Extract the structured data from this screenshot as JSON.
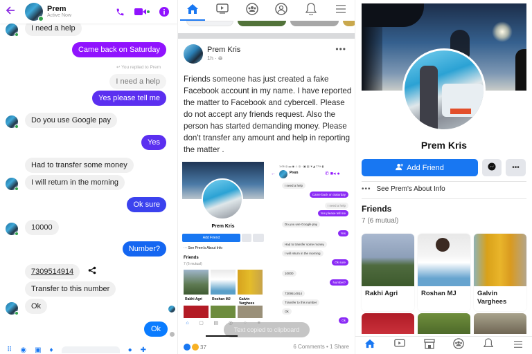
{
  "messenger": {
    "contact_name": "Prem",
    "status": "Active Now",
    "messages": [
      {
        "dir": "in",
        "text": "I need a help"
      },
      {
        "dir": "out",
        "text": "Came back on Saturday"
      },
      {
        "dir": "note",
        "text": "You replied to Prem"
      },
      {
        "dir": "quoted",
        "text": "I need a help"
      },
      {
        "dir": "out",
        "text": "Yes please tell me"
      },
      {
        "dir": "in",
        "text": "Do you use Google pay"
      },
      {
        "dir": "out",
        "text": "Yes"
      },
      {
        "dir": "in",
        "text": "Had to transfer some money"
      },
      {
        "dir": "in",
        "text": "I will return in the morning"
      },
      {
        "dir": "out",
        "text": "Ok sure"
      },
      {
        "dir": "in",
        "text": "10000"
      },
      {
        "dir": "out",
        "text": "Number?"
      },
      {
        "dir": "in",
        "text": "7309514914"
      },
      {
        "dir": "in",
        "text": "Transfer to this number"
      },
      {
        "dir": "in",
        "text": "Ok"
      },
      {
        "dir": "out",
        "text": "Ok"
      }
    ],
    "colors": {
      "accent": "#9013fe",
      "blue": "#0a7cff",
      "online": "#31a24c"
    }
  },
  "feed": {
    "nav": [
      "home-icon",
      "video-icon",
      "groups-icon",
      "profile-icon",
      "bell-icon",
      "menu-icon"
    ],
    "post": {
      "author": "Prem Kris",
      "time": "1h",
      "privacy": "globe-icon",
      "text": "Friends someone has just created a fake Facebook account in my name. I have reported the matter to Facebook and cybercell. Please do not accept any friends request. Also the person has started demanding money. Please don't transfer any amount  and help in reporting the matter .",
      "reaction_count": "37",
      "comments_shares": "6 Comments • 1 Share"
    },
    "embedded": {
      "profile_name": "Prem Kris",
      "add_friend": "Add Friend",
      "about": "See Prem's About Info",
      "friends_title": "Friends",
      "friends_count": "7 (6 mutual)",
      "friends": [
        "Rakhi Agri",
        "Roshan MJ",
        "Galvin Varghees"
      ],
      "toast": "Text copied to clipboard",
      "chat": [
        {
          "dir": "in",
          "text": "I need a help"
        },
        {
          "dir": "out",
          "text": "Came back on Saturday"
        },
        {
          "dir": "quoted",
          "text": "I need a help"
        },
        {
          "dir": "out",
          "text": "Yes please tell me"
        },
        {
          "dir": "in",
          "text": "Do you use Google pay"
        },
        {
          "dir": "out",
          "text": "Yes"
        },
        {
          "dir": "in",
          "text": "Had to transfer some money"
        },
        {
          "dir": "in",
          "text": "I will return in the morning"
        },
        {
          "dir": "out",
          "text": "Ok sure"
        },
        {
          "dir": "in",
          "text": "10000"
        },
        {
          "dir": "out",
          "text": "Number?"
        },
        {
          "dir": "in",
          "text": "7309514914"
        },
        {
          "dir": "in",
          "text": "Transfer to this number"
        },
        {
          "dir": "in",
          "text": "Ok"
        },
        {
          "dir": "out",
          "text": "Ok"
        }
      ]
    }
  },
  "profile": {
    "name": "Prem Kris",
    "add_friend_label": "Add Friend",
    "about_label": "See Prem's About Info",
    "friends_title": "Friends",
    "friends_count": "7 (6 mutual)",
    "friends": [
      {
        "name": "Rakhi Agri"
      },
      {
        "name": "Roshan MJ"
      },
      {
        "name": "Galvin Varghees"
      }
    ],
    "nav": [
      "home-icon",
      "video-icon",
      "marketplace-icon",
      "groups-icon",
      "bell-icon",
      "menu-icon"
    ],
    "colors": {
      "primary": "#1877f2",
      "secondary_btn": "#e4e6eb"
    }
  }
}
